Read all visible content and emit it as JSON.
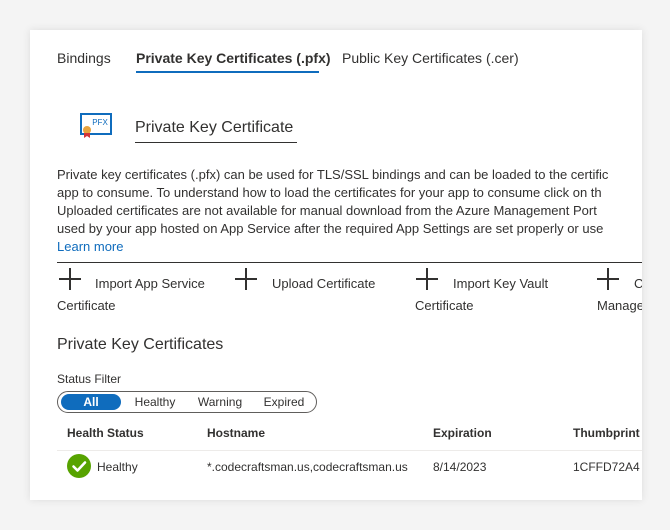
{
  "tabs": [
    {
      "label": "Bindings"
    },
    {
      "label": "Private Key Certificates (.pfx)"
    },
    {
      "label": "Public Key Certificates (.cer)"
    }
  ],
  "header": {
    "icon_text": "PFX",
    "title": "Private Key Certificate"
  },
  "description": {
    "lines": [
      "Private key certificates (.pfx) can be used for TLS/SSL bindings and can be loaded to the certific",
      "app to consume. To understand how to load the certificates for your app to consume click on th",
      "Uploaded certificates are not available for manual download from the Azure Management Port",
      "used by your app hosted on App Service after the required App Settings are set properly or use"
    ],
    "learn_more": "Learn more"
  },
  "commands": [
    {
      "line1": "Import App Service",
      "line2": "Certificate"
    },
    {
      "line1": "Upload Certificate",
      "line2": ""
    },
    {
      "line1": "Import Key Vault",
      "line2": "Certificate"
    },
    {
      "line1": "C",
      "line2": "Manage"
    }
  ],
  "section_title": "Private Key Certificates",
  "filter": {
    "label": "Status Filter",
    "options": [
      "All",
      "Healthy",
      "Warning",
      "Expired"
    ],
    "selected": "All"
  },
  "table": {
    "columns": [
      "Health Status",
      "Hostname",
      "Expiration",
      "Thumbprint"
    ],
    "rows": [
      {
        "status": "Healthy",
        "hostname": "*.codecraftsman.us,codecraftsman.us",
        "expiration": "8/14/2023",
        "thumbprint": "1CFFD72A4"
      }
    ]
  },
  "colors": {
    "accent": "#0f6cbd",
    "healthy": "#57a300",
    "text": "#323130"
  }
}
